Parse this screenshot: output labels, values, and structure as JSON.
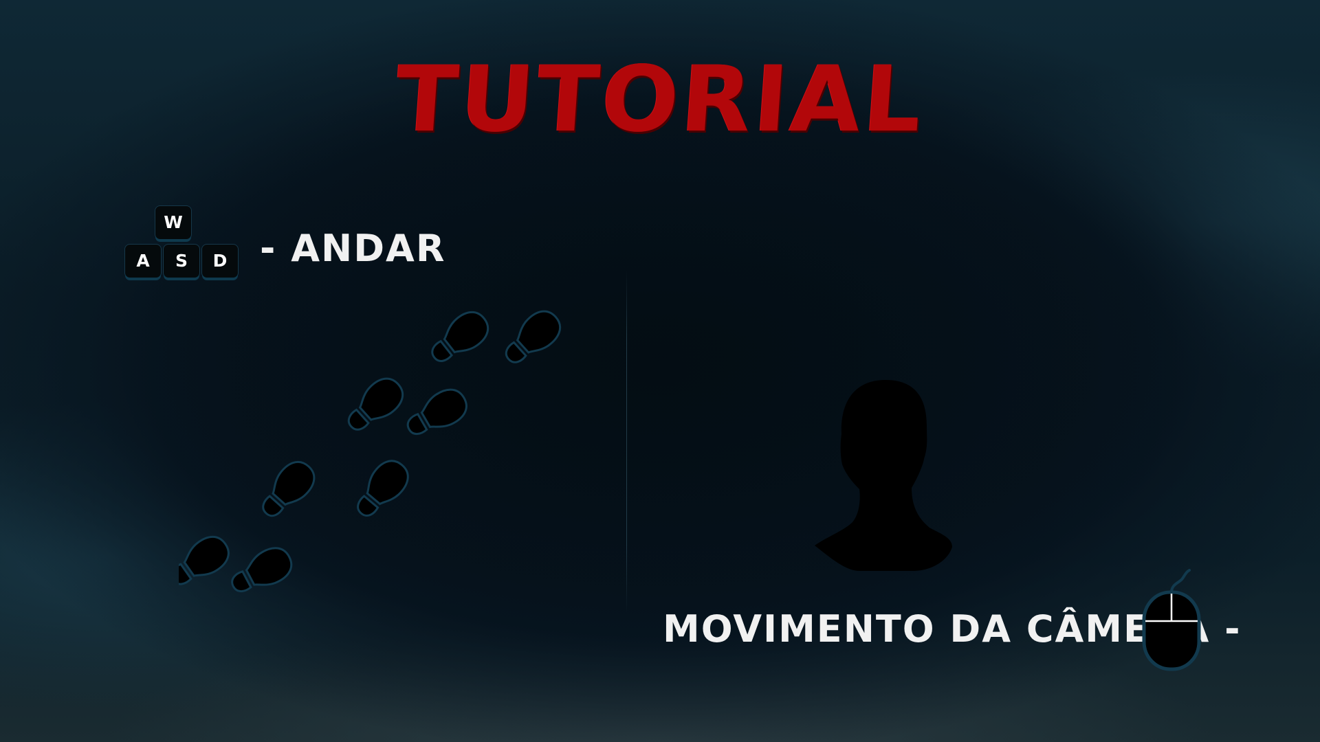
{
  "screen": {
    "title": "TUTORIAL",
    "title_color": "#b2070a",
    "background_color": "#0b1d27"
  },
  "controls": {
    "movement": {
      "keys": [
        "W",
        "A",
        "S",
        "D"
      ],
      "label": "- ANDAR",
      "illustration": "footprints-icon"
    },
    "camera": {
      "label": "MOVIMENTO DA CÂMERA -",
      "device": "mouse-icon",
      "illustration": "head-silhouette-icon"
    }
  }
}
